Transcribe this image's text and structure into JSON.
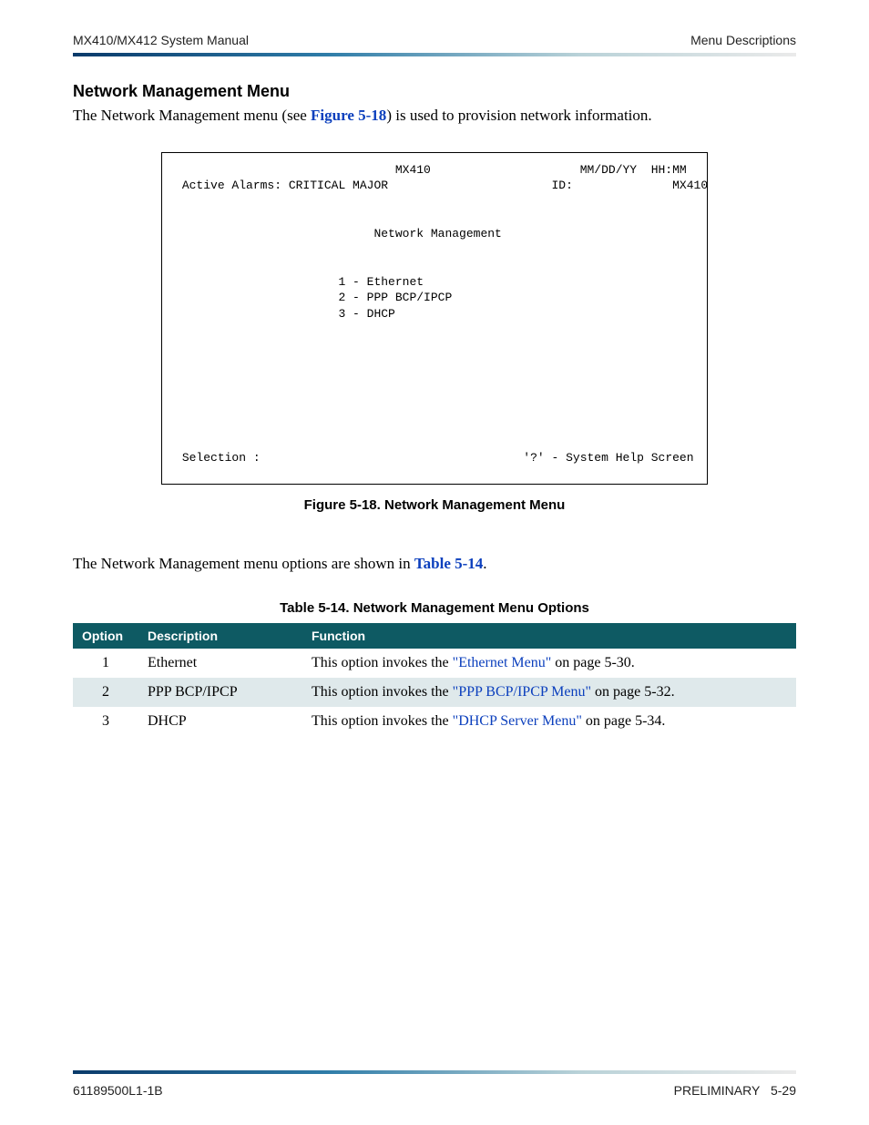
{
  "header": {
    "left": "MX410/MX412 System Manual",
    "right": "Menu Descriptions"
  },
  "section": {
    "title": "Network Management Menu",
    "intro_pre": "The Network Management menu (see ",
    "intro_link": "Figure 5-18",
    "intro_post": ") is used to provision network information."
  },
  "terminal": {
    "line_top_center": "MX410",
    "line_top_right": "MM/DD/YY  HH:MM",
    "alarm_label": "Active Alarms: CRITICAL MAJOR",
    "id_label": "ID:",
    "id_value": "MX410",
    "screen_title": "Network Management",
    "options": [
      "1 - Ethernet",
      "2 - PPP BCP/IPCP",
      "3 - DHCP"
    ],
    "selection_label": "Selection :",
    "help_label": "'?' - System Help Screen"
  },
  "figure_caption": "Figure 5-18.  Network Management Menu",
  "mid_para_pre": "The Network Management menu options are shown in ",
  "mid_para_link": "Table 5-14",
  "mid_para_post": ".",
  "table_caption": "Table 5-14.  Network Management Menu Options",
  "table": {
    "headers": {
      "option": "Option",
      "description": "Description",
      "function": "Function"
    },
    "rows": [
      {
        "option": "1",
        "description": "Ethernet",
        "func_pre": "This option invokes the ",
        "func_link": "\"Ethernet Menu\"",
        "func_post": " on page 5-30."
      },
      {
        "option": "2",
        "description": "PPP BCP/IPCP",
        "func_pre": "This option invokes the ",
        "func_link": "\"PPP BCP/IPCP Menu\"",
        "func_post": " on page 5-32."
      },
      {
        "option": "3",
        "description": "DHCP",
        "func_pre": "This option invokes the ",
        "func_link": "\"DHCP Server Menu\"",
        "func_post": " on page 5-34."
      }
    ]
  },
  "footer": {
    "left": "61189500L1-1B",
    "right_label": "PRELIMINARY",
    "right_page": "5-29"
  }
}
